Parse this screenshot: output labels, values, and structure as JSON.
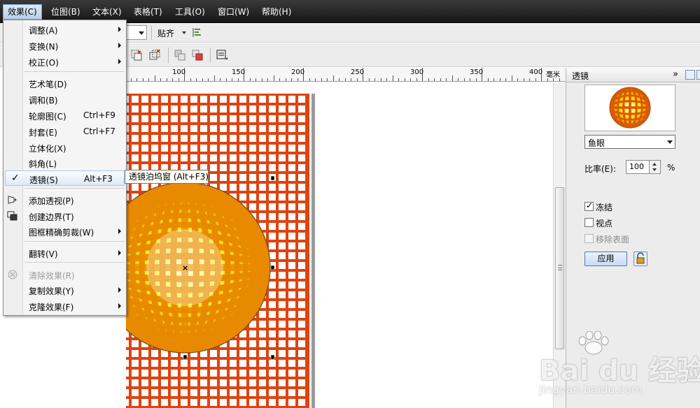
{
  "menubar": {
    "items": [
      "效果(C)",
      "位图(B)",
      "文本(X)",
      "表格(T)",
      "工具(O)",
      "窗口(W)",
      "帮助(H)"
    ]
  },
  "propbar": {
    "snap_label": "贴齐"
  },
  "ruler": {
    "labels": [
      "100",
      "150",
      "200",
      "250",
      "300",
      "350",
      "400"
    ],
    "unit": "毫米"
  },
  "menu": {
    "items": [
      {
        "label": "调整(A)",
        "submenu": true
      },
      {
        "label": "变换(N)",
        "submenu": true
      },
      {
        "label": "校正(O)",
        "submenu": true
      },
      {
        "label": "艺术笔(D)"
      },
      {
        "label": "调和(B)"
      },
      {
        "label": "轮廓图(C)",
        "shortcut": "Ctrl+F9"
      },
      {
        "label": "封套(E)",
        "shortcut": "Ctrl+F7"
      },
      {
        "label": "立体化(X)"
      },
      {
        "label": "斜角(L)"
      },
      {
        "label": "透镜(S)",
        "shortcut": "Alt+F3",
        "checked": true
      },
      {
        "label": "添加透视(P)"
      },
      {
        "label": "创建边界(T)"
      },
      {
        "label": "图框精确剪裁(W)",
        "submenu": true
      },
      {
        "label": "翻转(V)",
        "submenu": true
      },
      {
        "label": "清除效果(R)",
        "disabled": true
      },
      {
        "label": "复制效果(Y)",
        "submenu": true
      },
      {
        "label": "克隆效果(F)",
        "submenu": true
      }
    ]
  },
  "tooltip": "透镜泊坞窗 (Alt+F3)",
  "docker": {
    "title": "透镜",
    "lens_type": "鱼眼",
    "ratio_label": "比率(E):",
    "ratio_value": "100",
    "ratio_unit": "%",
    "freeze_label": "冻结",
    "freeze_checked": true,
    "viewpoint_label": "视点",
    "viewpoint_checked": false,
    "remove_face_label": "移除表面",
    "remove_face_disabled": true,
    "apply_label": "应用"
  },
  "watermark": {
    "text": "Bai du 经验",
    "sub": "jingyan.baidu.com"
  },
  "colors": {
    "grid_orange": "#dd4411",
    "grid_cells": "#ffffff",
    "lens_yellow": "#ffee00",
    "lens_orange": "#ee8800",
    "menubar": "#1f1f1f"
  }
}
